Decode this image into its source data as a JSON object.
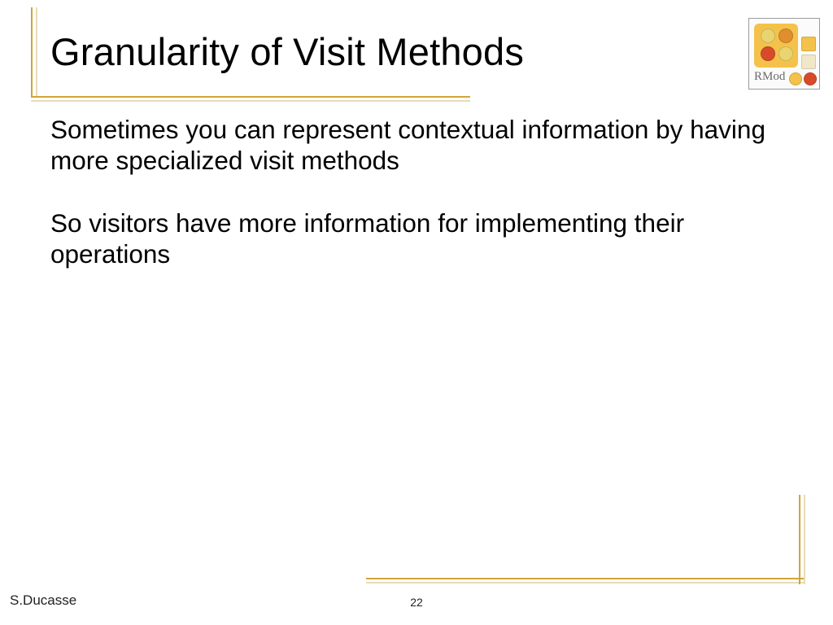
{
  "title": "Granularity of  Visit Methods",
  "logo": {
    "label": "RMod"
  },
  "body": [
    "Sometimes you can represent contextual information by having more specialized visit methods",
    "So visitors have more information for implementing their operations"
  ],
  "footer": {
    "author": "S.Ducasse",
    "page": "22"
  },
  "colors": {
    "accent": "#d0a638",
    "accent_light": "#e6dcb8",
    "logo_orange": "#f4c24a",
    "logo_red": "#d84b2a"
  }
}
